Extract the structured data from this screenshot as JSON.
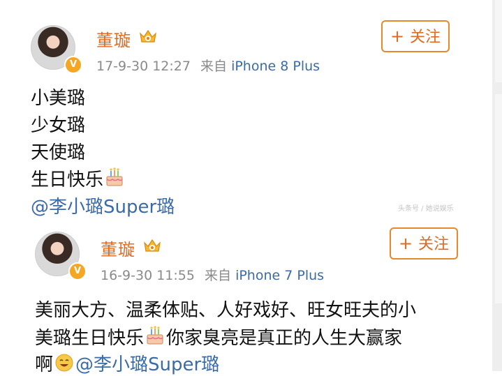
{
  "posts": [
    {
      "author": "董璇",
      "vip_badge": "V",
      "time": "17-9-30 12:27",
      "source_prefix": "来自",
      "source": "iPhone 8 Plus",
      "follow_label": "关注",
      "follow_plus": "+",
      "lines": [
        "小美璐",
        "少女璐",
        "天使璐",
        "生日快乐"
      ],
      "mention": "@李小璐Super璐"
    },
    {
      "author": "董璇",
      "vip_badge": "V",
      "time": "16-9-30 11:55",
      "source_prefix": "来自",
      "source": "iPhone 7 Plus",
      "follow_label": "关注",
      "follow_plus": "+",
      "lines": [
        "美丽大方、温柔体贴、人好戏好、旺女旺夫的小",
        "美璐生日快乐",
        "你家臭亮是真正的人生大赢家",
        "啊"
      ],
      "mention": "@李小璐Super璐"
    }
  ],
  "watermark": "头条号 / 她说娱乐",
  "icons": {
    "crown": "vip-crown-icon",
    "cake": "birthday-cake-emoji",
    "smile": "grin-emoji"
  },
  "colors": {
    "name": "#e06a1f",
    "link": "#3a6ba8",
    "meta": "#8a8a8a",
    "follow_border": "#e6892d"
  }
}
